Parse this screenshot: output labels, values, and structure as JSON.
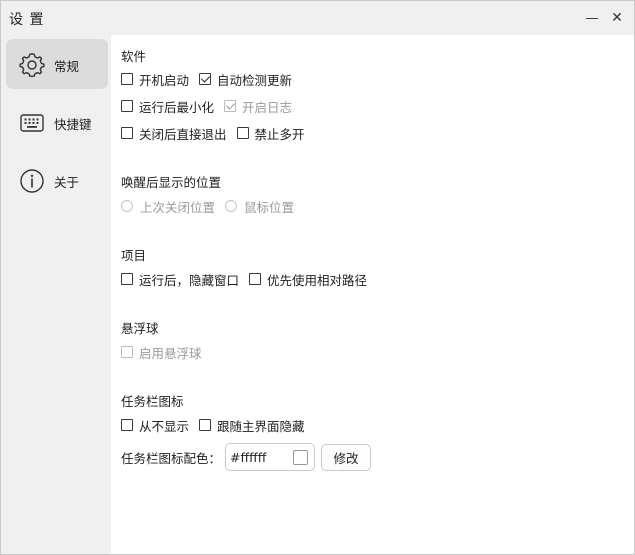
{
  "window": {
    "title": "设 置",
    "minimize_glyph": "—",
    "close_glyph": "✕"
  },
  "sidebar": {
    "items": [
      {
        "label": "常规",
        "icon": "gear-icon",
        "active": true
      },
      {
        "label": "快捷键",
        "icon": "keyboard-icon",
        "active": false
      },
      {
        "label": "关于",
        "icon": "info-icon",
        "active": false
      }
    ]
  },
  "software": {
    "title": "软件",
    "launch_on_boot": {
      "label": "开机启动",
      "checked": false
    },
    "auto_check_update": {
      "label": "自动检测更新",
      "checked": true
    },
    "minimize_after_run": {
      "label": "运行后最小化",
      "checked": false
    },
    "enable_log": {
      "label": "开启日志",
      "checked": true,
      "disabled": true
    },
    "exit_on_close": {
      "label": "关闭后直接退出",
      "checked": false
    },
    "disable_multi_open": {
      "label": "禁止多开",
      "checked": false
    }
  },
  "wake_position": {
    "title": "唤醒后显示的位置",
    "last_close_position": {
      "label": "上次关闭位置",
      "selected": false,
      "disabled": true
    },
    "mouse_position": {
      "label": "鼠标位置",
      "selected": false,
      "disabled": true
    }
  },
  "project": {
    "title": "项目",
    "hide_window_after_run": {
      "label": "运行后，隐藏窗口",
      "checked": false
    },
    "prefer_relative_path": {
      "label": "优先使用相对路径",
      "checked": false
    }
  },
  "floating_ball": {
    "title": "悬浮球",
    "enable_floating_ball": {
      "label": "启用悬浮球",
      "checked": false,
      "disabled": true
    }
  },
  "taskbar_icon": {
    "title": "任务栏图标",
    "never_show": {
      "label": "从不显示",
      "checked": false
    },
    "hide_with_main": {
      "label": "跟随主界面隐藏",
      "checked": false
    },
    "color_label": "任务栏图标配色：",
    "color_value": "#ffffff",
    "modify_label": "修改"
  },
  "colors": {
    "titlebar_bg": "#f0f0f0",
    "sidebar_bg": "#f0f0f0",
    "active_item_bg": "#dcdcdc",
    "disabled_text": "#9a9a9a"
  }
}
